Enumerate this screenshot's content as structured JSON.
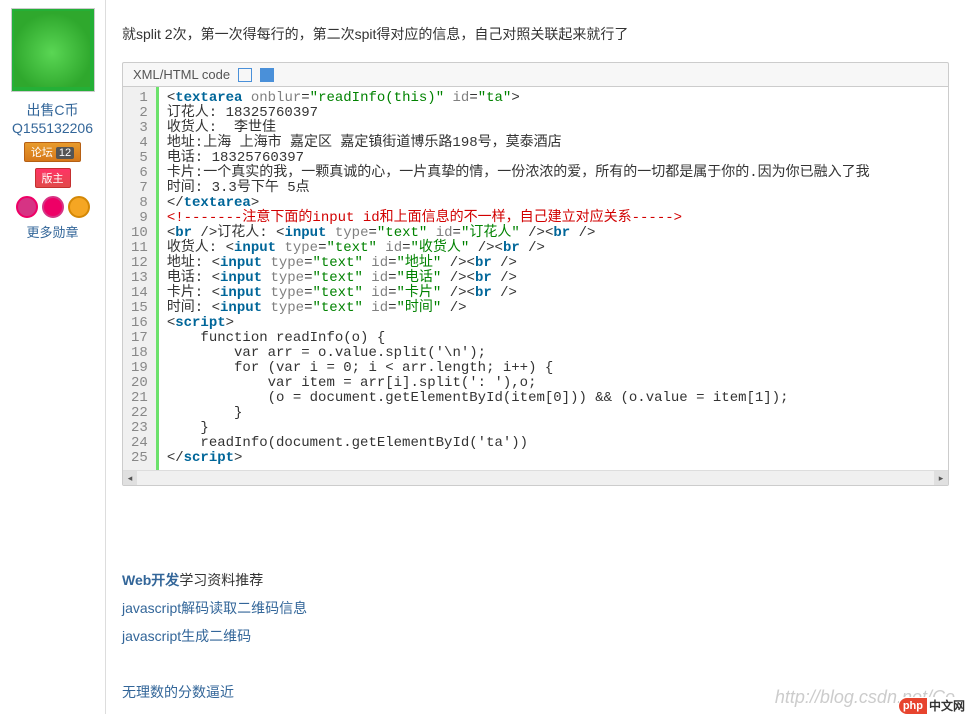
{
  "sidebar": {
    "username": "出售C币Q155132206",
    "badge_forum": "论坛",
    "badge_num": "12",
    "badge_owner": "版主",
    "more_medals": "更多勋章"
  },
  "post": {
    "description": "就split 2次，第一次得每行的，第二次spit得对应的信息，自己对照关联起来就行了"
  },
  "code": {
    "header": "XML/HTML code",
    "lines": [
      {
        "n": 1,
        "html": "&lt;<span class='tag'>textarea</span> <span class='attr'>onblur</span>=<span class='str'>\"readInfo(this)\"</span> <span class='attr'>id</span>=<span class='str'>\"ta\"</span>&gt;"
      },
      {
        "n": 2,
        "html": "订花人: 18325760397"
      },
      {
        "n": 3,
        "html": "收货人:  李世佳"
      },
      {
        "n": 4,
        "html": "地址:上海 上海市 嘉定区 嘉定镇街道博乐路198号，莫泰酒店"
      },
      {
        "n": 5,
        "html": "电话: 18325760397"
      },
      {
        "n": 6,
        "html": "卡片:一个真实的我，一颗真诚的心，一片真挚的情，一份浓浓的爱，所有的一切都是属于你的.因为你已融入了我"
      },
      {
        "n": 7,
        "html": "时间: 3.3号下午 5点"
      },
      {
        "n": 8,
        "html": "&lt;/<span class='tag'>textarea</span>&gt;"
      },
      {
        "n": 9,
        "html": "<span class='comment'>&lt;!-------注意下面的input id和上面信息的不一样，自己建立对应关系-----&gt;</span>"
      },
      {
        "n": 10,
        "html": "&lt;<span class='tag'>br</span> /&gt;订花人: &lt;<span class='tag'>input</span> <span class='attr'>type</span>=<span class='str'>\"text\"</span> <span class='attr'>id</span>=<span class='str'>\"订花人\"</span> /&gt;&lt;<span class='tag'>br</span> /&gt;"
      },
      {
        "n": 11,
        "html": "收货人: &lt;<span class='tag'>input</span> <span class='attr'>type</span>=<span class='str'>\"text\"</span> <span class='attr'>id</span>=<span class='str'>\"收货人\"</span> /&gt;&lt;<span class='tag'>br</span> /&gt;"
      },
      {
        "n": 12,
        "html": "地址: &lt;<span class='tag'>input</span> <span class='attr'>type</span>=<span class='str'>\"text\"</span> <span class='attr'>id</span>=<span class='str'>\"地址\"</span> /&gt;&lt;<span class='tag'>br</span> /&gt;"
      },
      {
        "n": 13,
        "html": "电话: &lt;<span class='tag'>input</span> <span class='attr'>type</span>=<span class='str'>\"text\"</span> <span class='attr'>id</span>=<span class='str'>\"电话\"</span> /&gt;&lt;<span class='tag'>br</span> /&gt;"
      },
      {
        "n": 14,
        "html": "卡片: &lt;<span class='tag'>input</span> <span class='attr'>type</span>=<span class='str'>\"text\"</span> <span class='attr'>id</span>=<span class='str'>\"卡片\"</span> /&gt;&lt;<span class='tag'>br</span> /&gt;"
      },
      {
        "n": 15,
        "html": "时间: &lt;<span class='tag'>input</span> <span class='attr'>type</span>=<span class='str'>\"text\"</span> <span class='attr'>id</span>=<span class='str'>\"时间\"</span> /&gt;"
      },
      {
        "n": 16,
        "html": "&lt;<span class='tag'>script</span>&gt;"
      },
      {
        "n": 17,
        "html": "    function readInfo(o) {"
      },
      {
        "n": 18,
        "html": "        var arr = o.value.split('\\n');"
      },
      {
        "n": 19,
        "html": "        for (var i = 0; i &lt; arr.length; i++) {"
      },
      {
        "n": 20,
        "html": "            var item = arr[i].split(': '),o;"
      },
      {
        "n": 21,
        "html": "            (o = document.getElementById(item[0])) &amp;&amp; (o.value = item[1]);"
      },
      {
        "n": 22,
        "html": "        }"
      },
      {
        "n": 23,
        "html": "    }"
      },
      {
        "n": 24,
        "html": "    readInfo(document.getElementById('ta'))"
      },
      {
        "n": 25,
        "html": "&lt;/<span class='tag'>script</span>&gt;"
      }
    ]
  },
  "footer": {
    "heading_bold": "Web开发",
    "heading_rest": "学习资料推荐",
    "link1": "javascript解码读取二维码信息",
    "link2": "javascript生成二维码",
    "link3": "无理数的分数逼近"
  },
  "watermark": "http://blog.csdn.net/Co",
  "corner": {
    "php": "php",
    "cn": "中文网"
  }
}
